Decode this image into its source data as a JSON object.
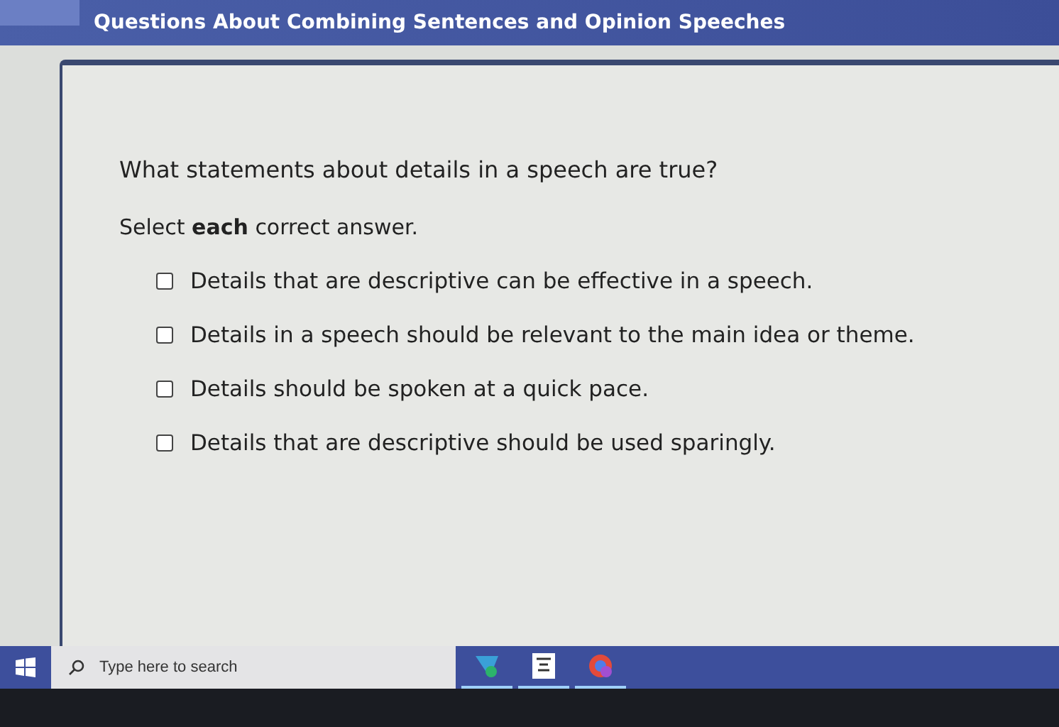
{
  "header": {
    "title": "Questions About Combining Sentences and Opinion Speeches"
  },
  "question": {
    "prompt": "What statements about details in a speech are true?",
    "instruction": "Select **each** correct answer.",
    "options": [
      {
        "label": "Details that are descriptive can be effective in a speech.",
        "checked": false
      },
      {
        "label": "Details in a speech should be relevant to the main idea or theme.",
        "checked": false
      },
      {
        "label": "Details should be spoken at a quick pace.",
        "checked": false
      },
      {
        "label": "Details that are descriptive should be used sparingly.",
        "checked": false
      }
    ]
  },
  "taskbar": {
    "search": {
      "placeholder": "Type here to search"
    }
  }
}
